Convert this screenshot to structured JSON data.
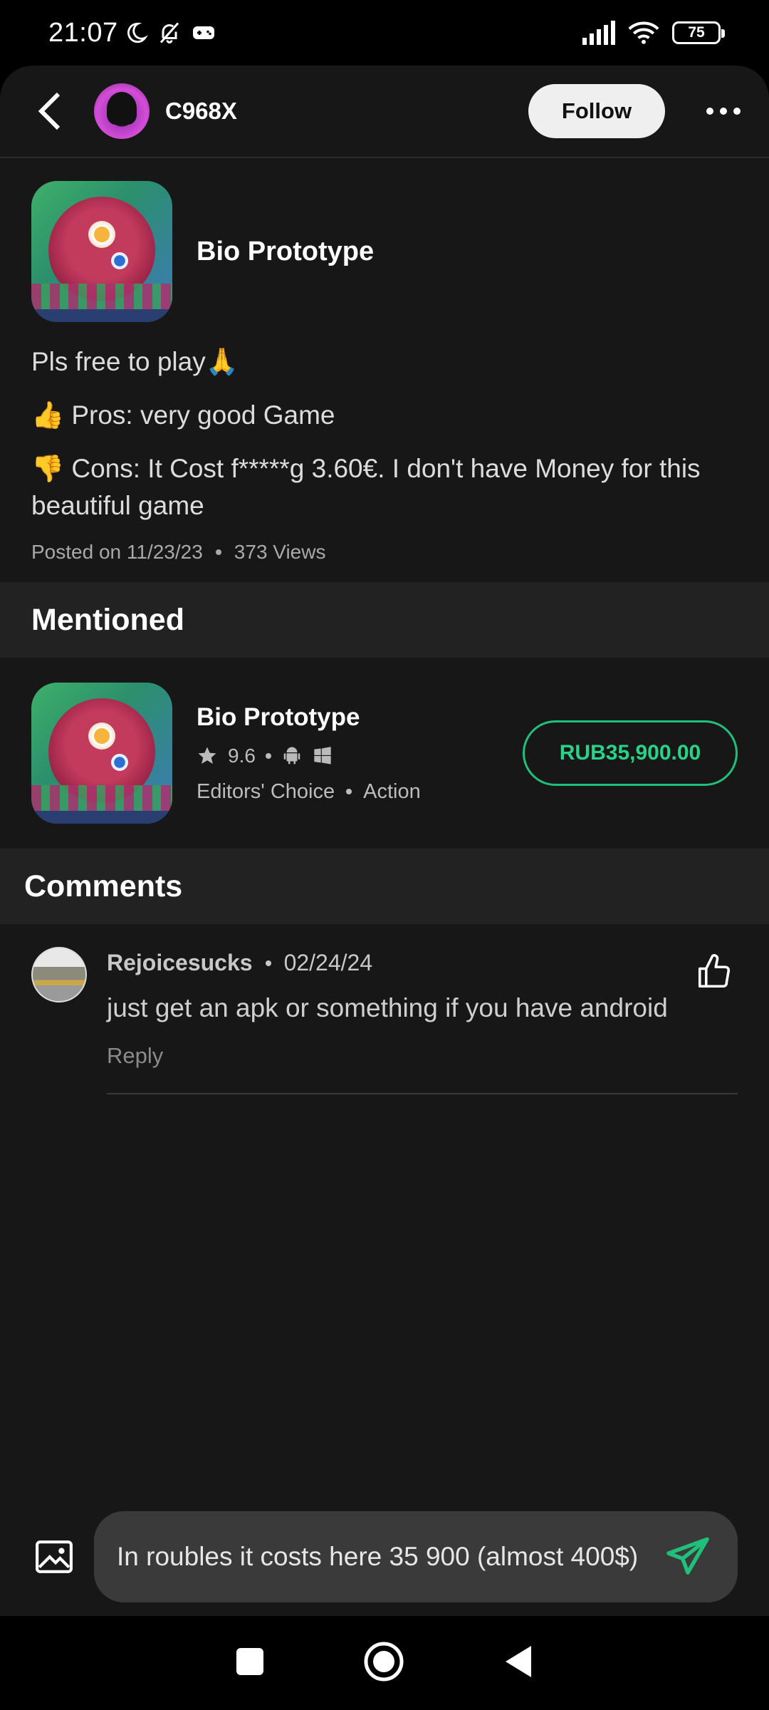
{
  "status_bar": {
    "time": "21:07",
    "battery": "75"
  },
  "header": {
    "author_name": "C968X",
    "follow_label": "Follow"
  },
  "post": {
    "game_title": "Bio Prototype",
    "lines": [
      "Pls free to play🙏",
      "👍 Pros: very good Game",
      "👎 Cons: It Cost f*****g 3.60€. I don't have Money for this beautiful game"
    ],
    "posted": "Posted on 11/23/23",
    "views": "373  Views"
  },
  "mentioned": {
    "section_title": "Mentioned",
    "game_title": "Bio Prototype",
    "rating": "9.6",
    "tag1": "Editors' Choice",
    "tag2": "Action",
    "price": "RUB35,900.00"
  },
  "comments": {
    "section_title": "Comments",
    "items": [
      {
        "user": "Rejoicesucks",
        "date": "02/24/24",
        "text": "just get an apk or something if you have android",
        "reply_label": "Reply"
      }
    ]
  },
  "input": {
    "value": "In roubles it costs here 35 900 (almost 400$)"
  },
  "colors": {
    "accent": "#20c07a",
    "background": "#171717",
    "section": "#222222"
  }
}
